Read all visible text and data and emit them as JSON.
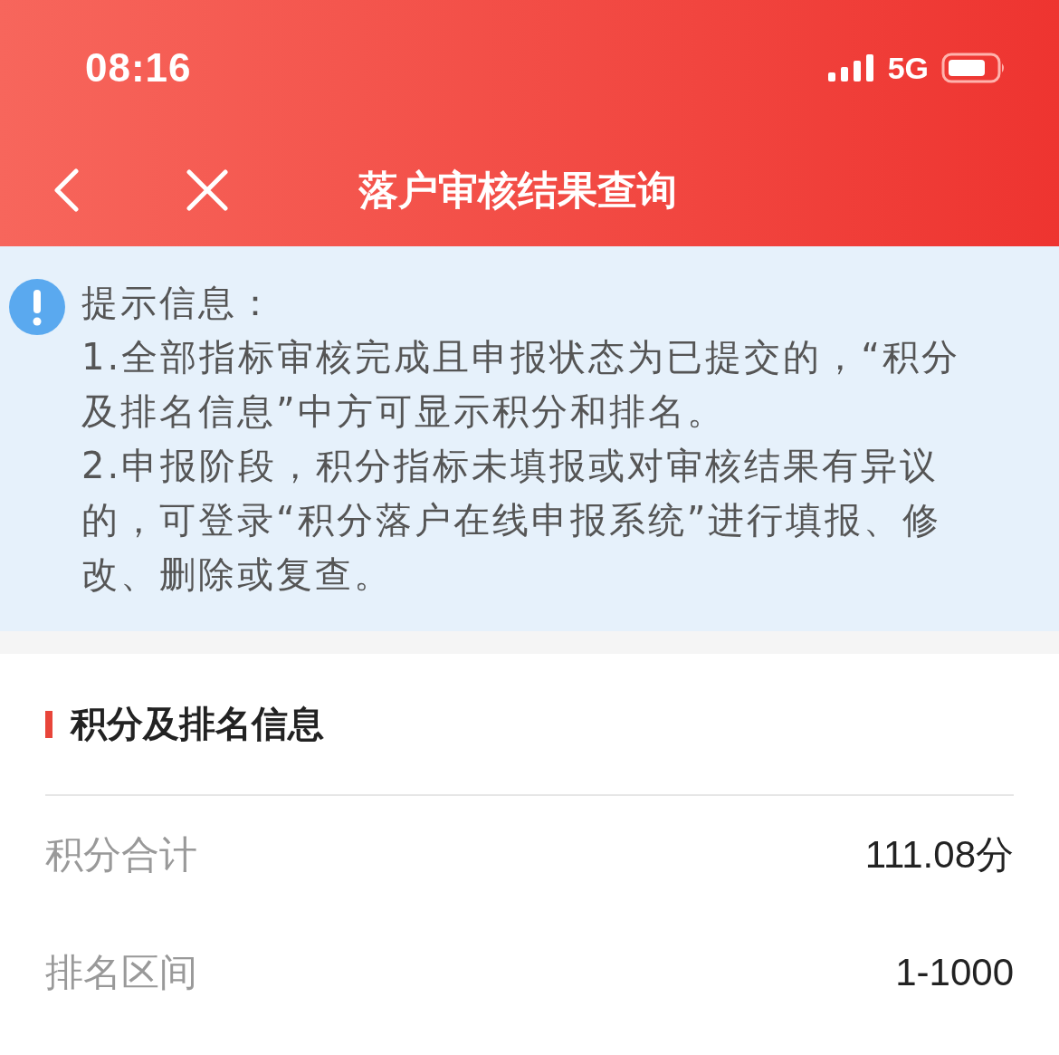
{
  "status_bar": {
    "time": "08:16",
    "network": "5G"
  },
  "nav_bar": {
    "title": "落户审核结果查询"
  },
  "notice": {
    "title": "提示信息：",
    "items": [
      "1.全部指标审核完成且申报状态为已提交的，“积分及排名信息”中方可显示积分和排名。",
      "2.申报阶段，积分指标未填报或对审核结果有异议的，可登录“积分落户在线申报系统”进行填报、修改、删除或复查。"
    ]
  },
  "section": {
    "title": "积分及排名信息",
    "rows": [
      {
        "label": "积分合计",
        "value": "111.08分"
      },
      {
        "label": "排名区间",
        "value": "1-1000"
      }
    ]
  }
}
